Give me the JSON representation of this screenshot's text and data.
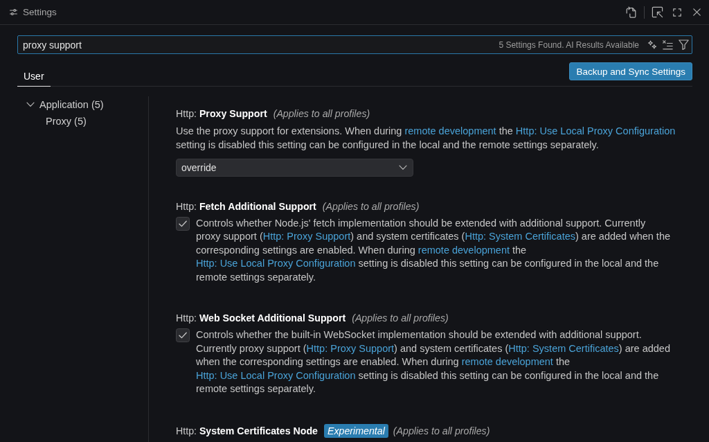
{
  "window": {
    "title": "Settings"
  },
  "search": {
    "value": "proxy support",
    "result_summary": "5 Settings Found. AI Results Available"
  },
  "tabs": [
    {
      "label": "User",
      "selected": true
    }
  ],
  "sync_button": {
    "label": "Backup and Sync Settings"
  },
  "tree": [
    {
      "label": "Application (5)",
      "expanded": true,
      "children": [
        {
          "label": "Proxy (5)"
        }
      ]
    }
  ],
  "settings": [
    {
      "kind": "dropdown",
      "title": "Http: **Proxy Support**",
      "scope": "(Applies to all profiles)",
      "description": [
        {
          "kind": "text",
          "text": "Use the proxy support for extensions. When during "
        },
        {
          "kind": "link",
          "text": "remote development"
        },
        {
          "kind": "text",
          "text": " the "
        },
        {
          "kind": "link",
          "text": "Http: Use Local Proxy Configuration"
        },
        {
          "kind": "text",
          "text": " setting is disabled this setting can be configured in the local and the remote settings separately."
        }
      ],
      "value": "override"
    },
    {
      "kind": "checkbox",
      "title": "Http: **Fetch Additional Support**",
      "scope": "(Applies to all profiles)",
      "checked": true,
      "description": [
        {
          "kind": "text",
          "text": "Controls whether Node.js' fetch implementation should be extended with additional support. Currently proxy support ("
        },
        {
          "kind": "link",
          "text": "Http: Proxy Support"
        },
        {
          "kind": "text",
          "text": ") and system certificates ("
        },
        {
          "kind": "link",
          "text": "Http: System Certificates"
        },
        {
          "kind": "text",
          "text": ") are added when the corresponding settings are enabled. When during "
        },
        {
          "kind": "link",
          "text": "remote development"
        },
        {
          "kind": "text",
          "text": " the "
        },
        {
          "kind": "link",
          "text": "Http: Use Local Proxy Configuration"
        },
        {
          "kind": "text",
          "text": " setting is disabled this setting can be configured in the local and the remote settings separately."
        }
      ]
    },
    {
      "kind": "checkbox",
      "title": "Http: **Web Socket Additional Support**",
      "scope": "(Applies to all profiles)",
      "checked": true,
      "description": [
        {
          "kind": "text",
          "text": "Controls whether the built-in WebSocket implementation should be extended with additional support. Currently proxy support ("
        },
        {
          "kind": "link",
          "text": "Http: Proxy Support"
        },
        {
          "kind": "text",
          "text": ") and system certificates ("
        },
        {
          "kind": "link",
          "text": "Http: System Certificates"
        },
        {
          "kind": "text",
          "text": ") are added when the corresponding settings are enabled. When during "
        },
        {
          "kind": "link",
          "text": "remote development"
        },
        {
          "kind": "text",
          "text": " the "
        },
        {
          "kind": "link",
          "text": "Http: Use Local Proxy Configuration"
        },
        {
          "kind": "text",
          "text": " setting is disabled this setting can be configured in the local and the remote settings separately."
        }
      ]
    },
    {
      "kind": "title_only",
      "title": "Http: **System Certificates Node**",
      "tag": "Experimental",
      "scope": "(Applies to all profiles)"
    }
  ]
}
